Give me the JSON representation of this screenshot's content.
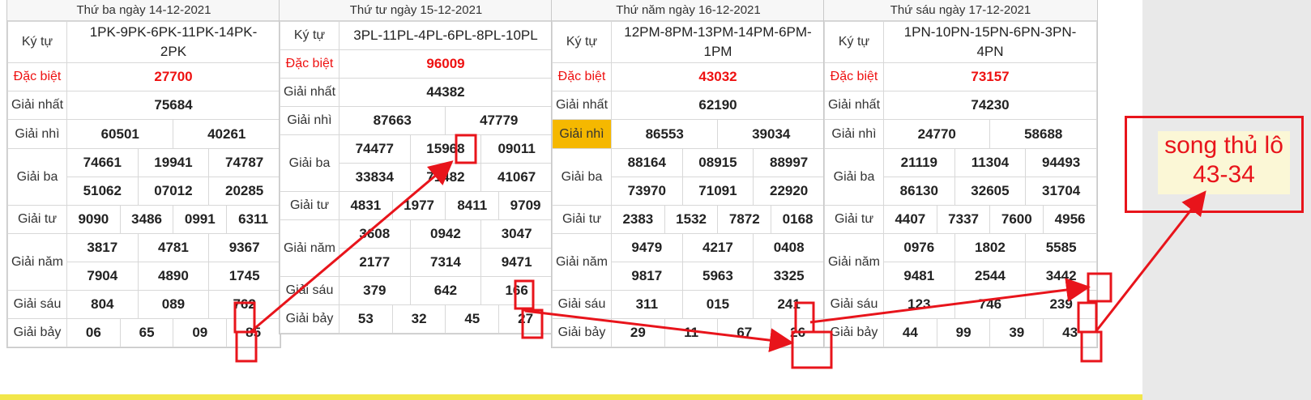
{
  "labels": {
    "ky_tu": "Ký tự",
    "dac_biet": "Đặc biệt",
    "giai_nhat": "Giải nhất",
    "giai_nhi": "Giải nhì",
    "giai_ba": "Giải ba",
    "giai_tu": "Giải tư",
    "giai_nam": "Giải năm",
    "giai_sau": "Giải sáu",
    "giai_bay": "Giải bảy"
  },
  "cards": [
    {
      "title": "Thứ ba ngày 14-12-2021",
      "code_line1": "1PK-9PK-6PK-11PK-14PK-",
      "code_line2": "2PK",
      "dac_biet": "27700",
      "nhat": "75684",
      "nhi": [
        "60501",
        "40261"
      ],
      "ba": [
        "74661",
        "19941",
        "74787",
        "51062",
        "07012",
        "20285"
      ],
      "tu": [
        "9090",
        "3486",
        "0991",
        "6311"
      ],
      "nam": [
        "3817",
        "4781",
        "9367",
        "7904",
        "4890",
        "1745"
      ],
      "sau": [
        "804",
        "089",
        "762"
      ],
      "bay": [
        "06",
        "65",
        "09",
        "85"
      ]
    },
    {
      "title": "Thứ tư ngày 15-12-2021",
      "code_line1": "3PL-11PL-4PL-6PL-8PL-10PL",
      "code_line2": "",
      "dac_biet": "96009",
      "nhat": "44382",
      "nhi": [
        "87663",
        "47779"
      ],
      "ba": [
        "74477",
        "15968",
        "09011",
        "33834",
        "71482",
        "41067"
      ],
      "tu": [
        "4831",
        "1977",
        "8411",
        "9709"
      ],
      "nam": [
        "3608",
        "0942",
        "3047",
        "2177",
        "7314",
        "9471"
      ],
      "sau": [
        "379",
        "642",
        "166"
      ],
      "bay": [
        "53",
        "32",
        "45",
        "27"
      ]
    },
    {
      "title": "Thứ năm ngày 16-12-2021",
      "code_line1": "12PM-8PM-13PM-14PM-6PM-",
      "code_line2": "1PM",
      "dac_biet": "43032",
      "nhat": "62190",
      "nhi": [
        "86553",
        "39034"
      ],
      "ba": [
        "88164",
        "08915",
        "88997",
        "73970",
        "71091",
        "22920"
      ],
      "tu": [
        "2383",
        "1532",
        "7872",
        "0168"
      ],
      "nam": [
        "9479",
        "4217",
        "0408",
        "9817",
        "5963",
        "3325"
      ],
      "sau": [
        "311",
        "015",
        "241"
      ],
      "bay": [
        "29",
        "11",
        "67",
        "26"
      ]
    },
    {
      "title": "Thứ sáu ngày 17-12-2021",
      "code_line1": "1PN-10PN-15PN-6PN-3PN-",
      "code_line2": "4PN",
      "dac_biet": "73157",
      "nhat": "74230",
      "nhi": [
        "24770",
        "58688"
      ],
      "ba": [
        "21119",
        "11304",
        "94493",
        "86130",
        "32605",
        "31704"
      ],
      "tu": [
        "4407",
        "7337",
        "7600",
        "4956"
      ],
      "nam": [
        "0976",
        "1802",
        "5585",
        "9481",
        "2544",
        "3442"
      ],
      "sau": [
        "123",
        "746",
        "239"
      ],
      "bay": [
        "44",
        "99",
        "39",
        "43"
      ]
    }
  ],
  "callout": {
    "line1": "song thủ lô",
    "line2": "43-34"
  },
  "colors": {
    "red": "#e8141b",
    "highlight": "#f5b800",
    "yellow_bar": "#f2e64a"
  }
}
